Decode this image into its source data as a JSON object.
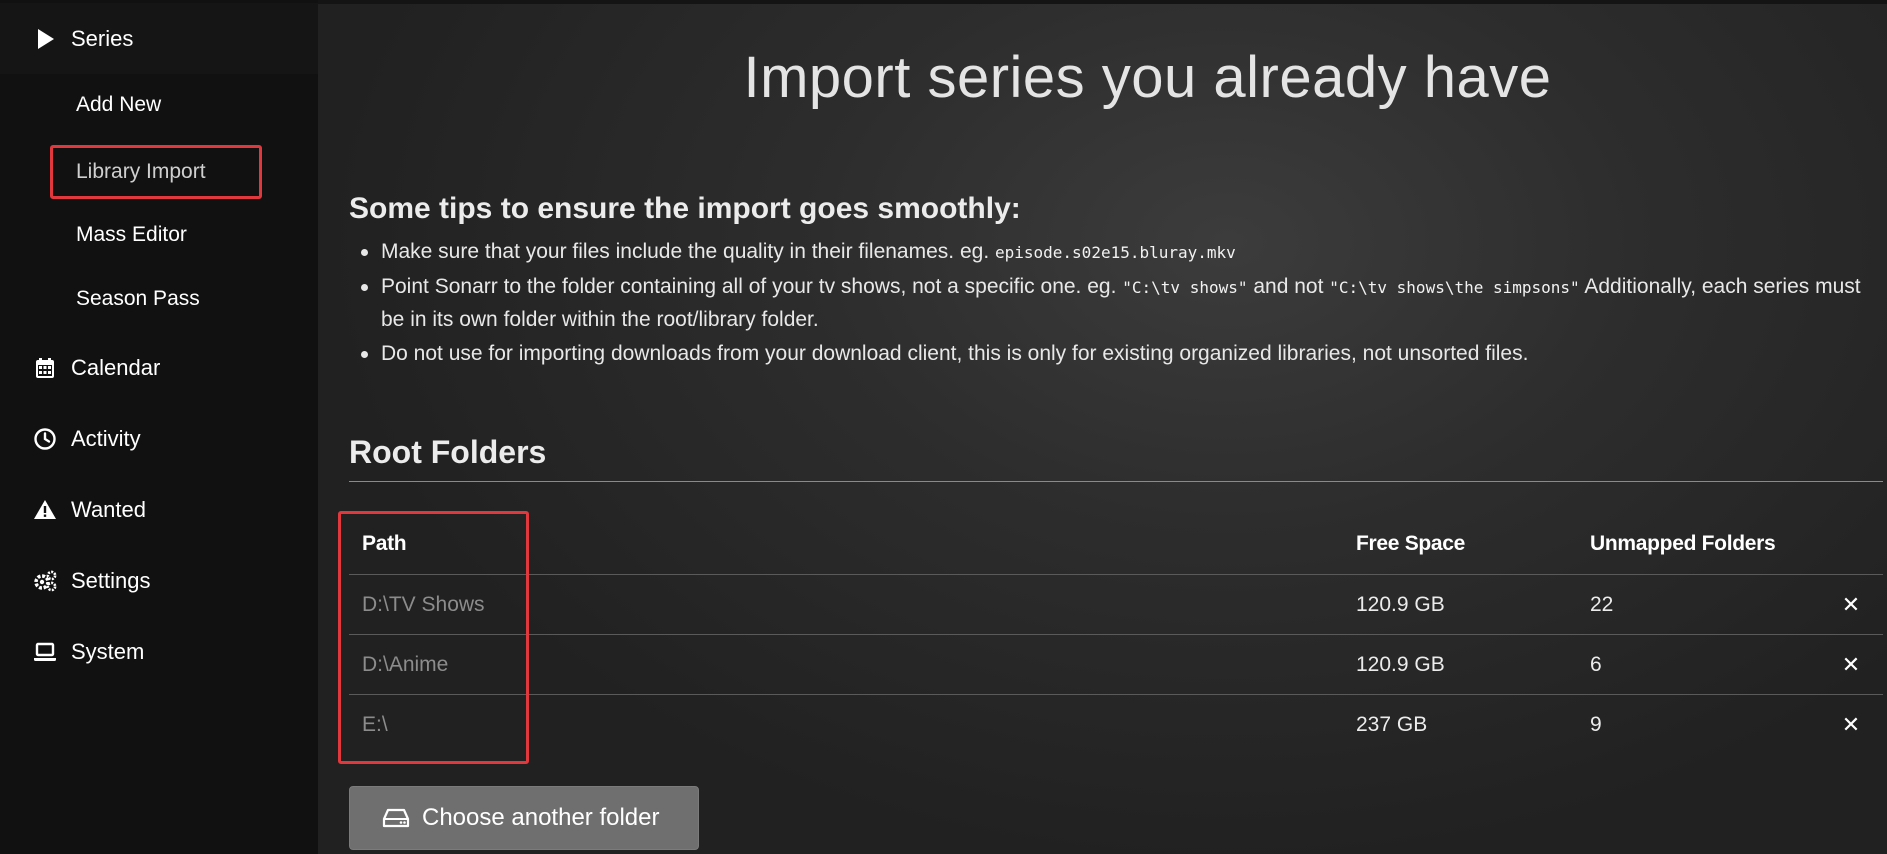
{
  "sidebar": {
    "items": [
      {
        "label": "Series",
        "icon": "play-icon"
      },
      {
        "label": "Calendar",
        "icon": "calendar-icon"
      },
      {
        "label": "Activity",
        "icon": "clock-icon"
      },
      {
        "label": "Wanted",
        "icon": "warning-icon"
      },
      {
        "label": "Settings",
        "icon": "gears-icon"
      },
      {
        "label": "System",
        "icon": "laptop-icon"
      }
    ],
    "series_subitems": [
      {
        "label": "Add New"
      },
      {
        "label": "Library Import",
        "active": true
      },
      {
        "label": "Mass Editor"
      },
      {
        "label": "Season Pass"
      }
    ]
  },
  "main": {
    "title": "Import series you already have",
    "tips": {
      "heading": "Some tips to ensure the import goes smoothly:",
      "tip1_text": "Make sure that your files include the quality in their filenames. eg. ",
      "tip1_code": "episode.s02e15.bluray.mkv",
      "tip2_text_a": "Point Sonarr to the folder containing all of your tv shows, not a specific one. eg. ",
      "tip2_code_a": "\"C:\\tv shows\"",
      "tip2_text_b": " and not ",
      "tip2_code_b": "\"C:\\tv shows\\the simpsons\"",
      "tip2_text_c": " Additionally, each series must be in its own folder within the root/library folder.",
      "tip3_text": "Do not use for importing downloads from your download client, this is only for existing organized libraries, not unsorted files."
    },
    "root_folders": {
      "title": "Root Folders",
      "columns": {
        "path": "Path",
        "free_space": "Free Space",
        "unmapped": "Unmapped Folders"
      },
      "rows": [
        {
          "path": "D:\\TV Shows",
          "free_space": "120.9 GB",
          "unmapped": "22"
        },
        {
          "path": "D:\\Anime",
          "free_space": "120.9 GB",
          "unmapped": "6"
        },
        {
          "path": "E:\\",
          "free_space": "237 GB",
          "unmapped": "9"
        }
      ],
      "remove_symbol": "✕"
    },
    "choose_button": "Choose another folder"
  },
  "colors": {
    "sidebar_bg": "#111111",
    "main_bg": "#2d2d2d",
    "highlight": "#e0383d",
    "button_bg": "#6f6f6f"
  }
}
